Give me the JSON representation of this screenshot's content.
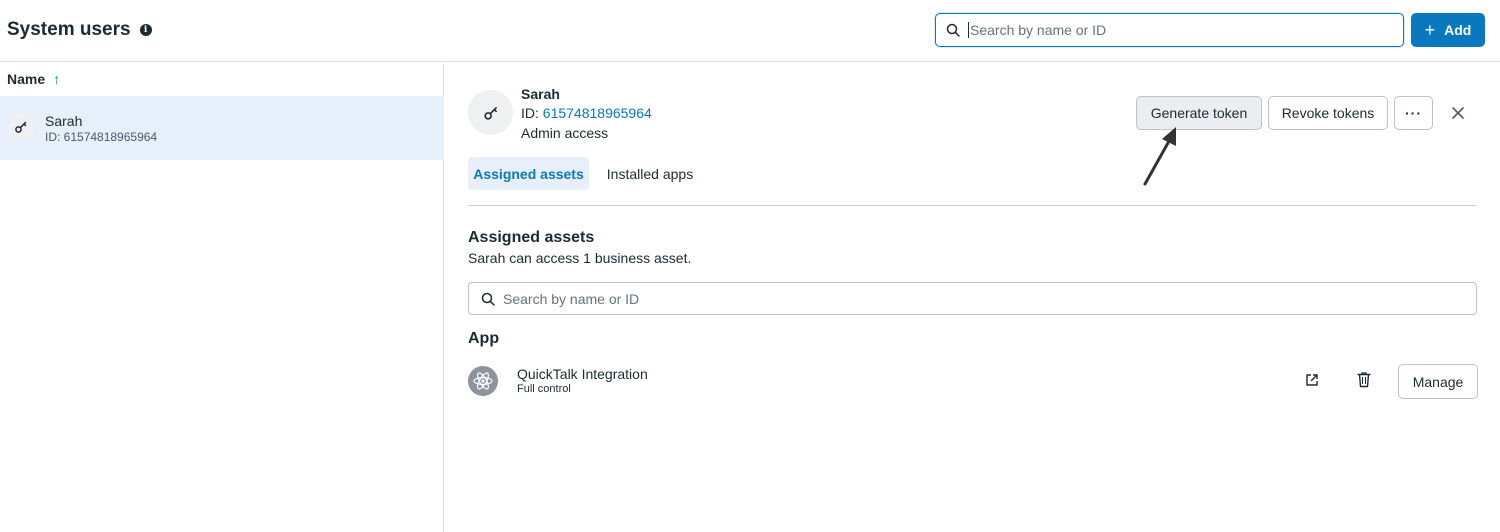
{
  "header": {
    "title": "System users",
    "search_placeholder": "Search by name or ID",
    "add_label": "Add"
  },
  "list": {
    "column_name": "Name",
    "users": [
      {
        "name": "Sarah",
        "id": "ID: 61574818965964"
      }
    ]
  },
  "detail": {
    "name": "Sarah",
    "id_prefix": "ID: ",
    "id_value": "61574818965964",
    "role": "Admin access",
    "buttons": {
      "generate_token": "Generate token",
      "revoke_tokens": "Revoke tokens",
      "more": "···"
    },
    "tabs": [
      {
        "label": "Assigned assets",
        "active": true
      },
      {
        "label": "Installed apps",
        "active": false
      }
    ],
    "assets": {
      "title": "Assigned assets",
      "subtitle": "Sarah can access 1 business asset.",
      "search_placeholder": "Search by name or ID",
      "group_title": "App",
      "items": [
        {
          "name": "QuickTalk Integration",
          "permission": "Full control",
          "manage_label": "Manage"
        }
      ]
    }
  },
  "colors": {
    "accent": "#0a78be",
    "selected_bg": "#e7f0fa",
    "text": "#1c2b33",
    "border": "#bec3c9"
  },
  "icons": [
    "info-icon",
    "search-icon",
    "plus-icon",
    "sort-up-arrow-icon",
    "key-icon",
    "close-icon",
    "app-atom-icon",
    "open-external-icon",
    "trash-icon",
    "annotation-arrow"
  ]
}
